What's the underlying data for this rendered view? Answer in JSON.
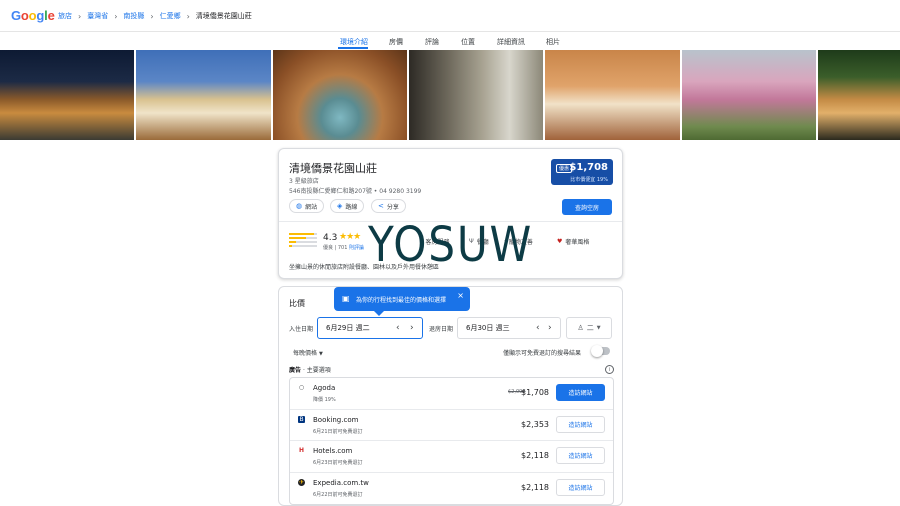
{
  "header": {
    "logo": [
      "G",
      "o",
      "o",
      "g",
      "l",
      "e"
    ],
    "logo_colors": [
      "#4285F4",
      "#EA4335",
      "#FBBC05",
      "#4285F4",
      "#34A853",
      "#EA4335"
    ],
    "breadcrumbs": [
      "旅店",
      "臺灣省",
      "南投縣",
      "仁愛鄉"
    ],
    "current": "清境僑景花園山莊"
  },
  "tabs": [
    "環境介紹",
    "房價",
    "評論",
    "位置",
    "詳細資訊",
    "相片"
  ],
  "hotel": {
    "name": "清境僑景花園山莊",
    "class": "3 星級旅店",
    "address": "546南投縣仁愛鄉仁和路207號 • 04 9280 3199",
    "actions": [
      "網站",
      "路線",
      "分享"
    ],
    "price_badge": "優惠",
    "price": "$1,708",
    "price_save": "比市價便宜 19%",
    "view_rooms": "查詢空房",
    "rating": "4.3",
    "stars": "★★★",
    "review_count": "優良 | 701",
    "review_link": "則評論",
    "amenities": [
      "客房服務",
      "餐廳",
      "寵物友善",
      "毒醫服務",
      "奢華風格"
    ],
    "description": "坐擁山景的休閒旅店附設餐廳、園林以及戶外用餐休憩區"
  },
  "watermark": "YOSUW",
  "pricing": {
    "title": "比價",
    "tooltip": "為你的行程找到最佳的價格和選擇",
    "checkin_label": "入住日期",
    "checkin_value": "6月29日 週二",
    "checkout_label": "退房日期",
    "checkout_value": "6月30日 週三",
    "guests": "二",
    "per_night": "每晚價格",
    "free_cancel": "僅顯示可免費退訂的搜尋結果",
    "ads_label": "廣告",
    "ads_suffix": "· 主要選項",
    "offers": [
      {
        "name": "Agoda",
        "sub": "降價 19%",
        "old": "$2,097",
        "price": "$1,708",
        "btn": "造訪網站",
        "logo": "○",
        "logo_bg": "#ffffff",
        "logo_color": "#3c4043"
      },
      {
        "name": "Booking.com",
        "sub": "6月21日前可免費退訂",
        "old": "",
        "price": "$2,353",
        "btn": "造訪網站",
        "logo": "B",
        "logo_bg": "#003580",
        "logo_color": "#ffffff"
      },
      {
        "name": "Hotels.com",
        "sub": "6月23日前可免費退訂",
        "old": "",
        "price": "$2,118",
        "btn": "造訪網站",
        "logo": "H",
        "logo_bg": "#ffffff",
        "logo_color": "#d32f2f"
      },
      {
        "name": "Expedia.com.tw",
        "sub": "6月22日前可免費退訂",
        "old": "",
        "price": "$2,118",
        "btn": "造訪網站",
        "logo": "✈",
        "logo_bg": "#202124",
        "logo_color": "#fbbc04"
      }
    ]
  }
}
